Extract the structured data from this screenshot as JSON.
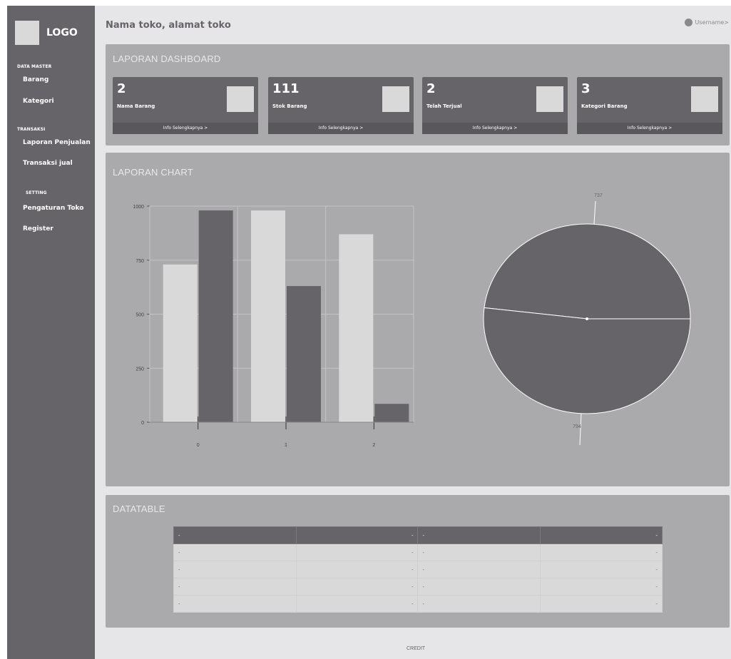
{
  "sidebar": {
    "logo": "LOGO",
    "sections": [
      {
        "label": "DATA MASTER",
        "items": [
          "Barang",
          "Kategori"
        ]
      },
      {
        "label": "TRANSAKSI",
        "items": [
          "Laporan Penjualan",
          "Transaksi jual"
        ]
      },
      {
        "label": "SETTING",
        "items": [
          "Pengaturan Toko",
          "Register"
        ]
      }
    ]
  },
  "header": {
    "title": "Nama toko, alamat toko",
    "username": "Username",
    "username_suffix": ">"
  },
  "dashboard": {
    "title": "LAPORAN DASHBOARD",
    "cards": [
      {
        "value": "2",
        "label": "Nama Barang",
        "link": "Info Selengkapnya >"
      },
      {
        "value": "111",
        "label": "Stok Barang",
        "link": "Info Selengkapnya >"
      },
      {
        "value": "2",
        "label": "Telah Terjual",
        "link": "Info Selengkapnya >"
      },
      {
        "value": "3",
        "label": "Kategori Barang",
        "link": "Info Selengkapnya >"
      }
    ]
  },
  "chart_section": {
    "title": "LAPORAN CHART"
  },
  "chart_data": [
    {
      "type": "bar",
      "categories": [
        "0",
        "1",
        "2"
      ],
      "series": [
        {
          "values": [
            730,
            980,
            870
          ],
          "color": "#d9d9d9"
        },
        {
          "values": [
            980,
            630,
            85
          ],
          "color": "#666469"
        }
      ],
      "yticks": [
        "0",
        "250",
        "500",
        "750",
        "1000"
      ],
      "ylim": [
        0,
        1000
      ],
      "grid": true
    },
    {
      "type": "pie",
      "values": [
        737,
        794
      ],
      "labels": [
        "737",
        "794"
      ],
      "color": "#666469"
    }
  ],
  "datatable": {
    "title": "DATATABLE",
    "header": [
      "-",
      "-",
      "-",
      "-"
    ],
    "rows": [
      [
        "-",
        "-",
        "-",
        "-"
      ],
      [
        "-",
        "-",
        "-",
        "-"
      ],
      [
        "-",
        "-",
        "-",
        "-"
      ],
      [
        "-",
        "-",
        "-",
        "-"
      ]
    ]
  },
  "footer": {
    "credit": "CREDIT"
  }
}
